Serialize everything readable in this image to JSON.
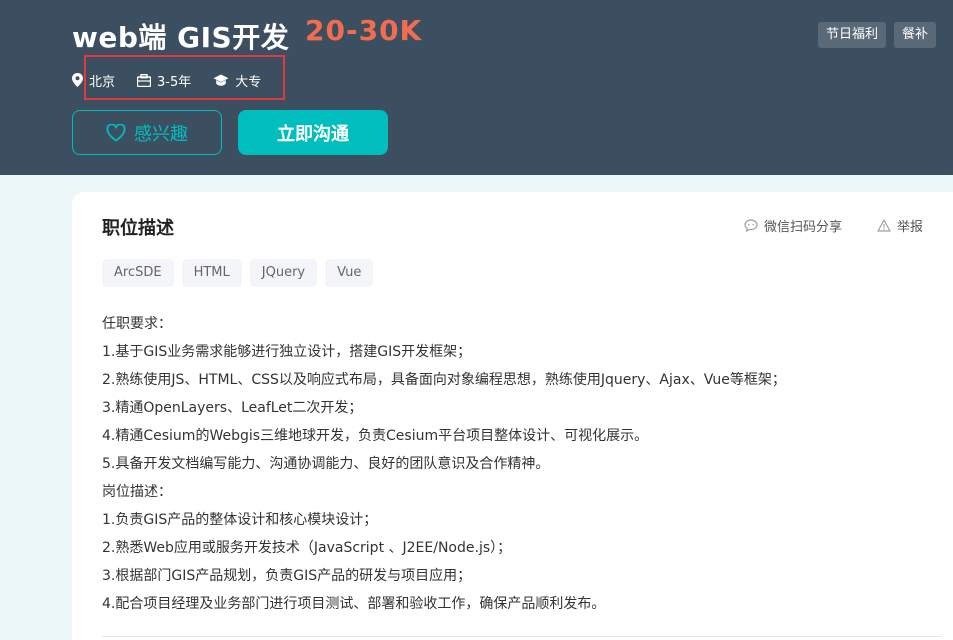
{
  "job": {
    "title": "web端 GIS开发",
    "salary": "20-30K",
    "location": "北京",
    "experience": "3-5年",
    "education": "大专"
  },
  "benefits": [
    "节日福利",
    "餐补"
  ],
  "actions": {
    "interest_label": "感兴趣",
    "chat_label": "立即沟通"
  },
  "description": {
    "title": "职位描述",
    "share_label": "微信扫码分享",
    "report_label": "举报",
    "skills": [
      "ArcSDE",
      "HTML",
      "JQuery",
      "Vue"
    ],
    "lines": [
      "任职要求：",
      "1.基于GIS业务需求能够进行独立设计，搭建GIS开发框架；",
      "2.熟练使用JS、HTML、CSS以及响应式布局，具备面向对象编程思想，熟练使用Jquery、Ajax、Vue等框架；",
      "3.精通OpenLayers、LeafLet二次开发；",
      "4.精通Cesium的Webgis三维地球开发，负责Cesium平台项目整体设计、可视化展示。",
      "5.具备开发文档编写能力、沟通协调能力、良好的团队意识及合作精神。",
      "岗位描述：",
      "1.负责GIS产品的整体设计和核心模块设计；",
      "2.熟悉Web应用或服务开发技术（JavaScript 、J2EE/Node.js）；",
      "3.根据部门GIS产品规划，负责GIS产品的研发与项目应用；",
      "4.配合项目经理及业务部门进行项目测试、部署和验收工作，确保产品顺利发布。"
    ]
  },
  "colors": {
    "header_bg": "#3c4f60",
    "accent": "#00bebd",
    "salary": "#f26d50",
    "highlight_box": "#e0393e"
  },
  "icons": {
    "location": "location-pin-icon",
    "experience": "briefcase-icon",
    "education": "graduation-cap-icon",
    "interest": "heart-icon",
    "share": "chat-bubble-icon",
    "report": "warning-icon"
  }
}
